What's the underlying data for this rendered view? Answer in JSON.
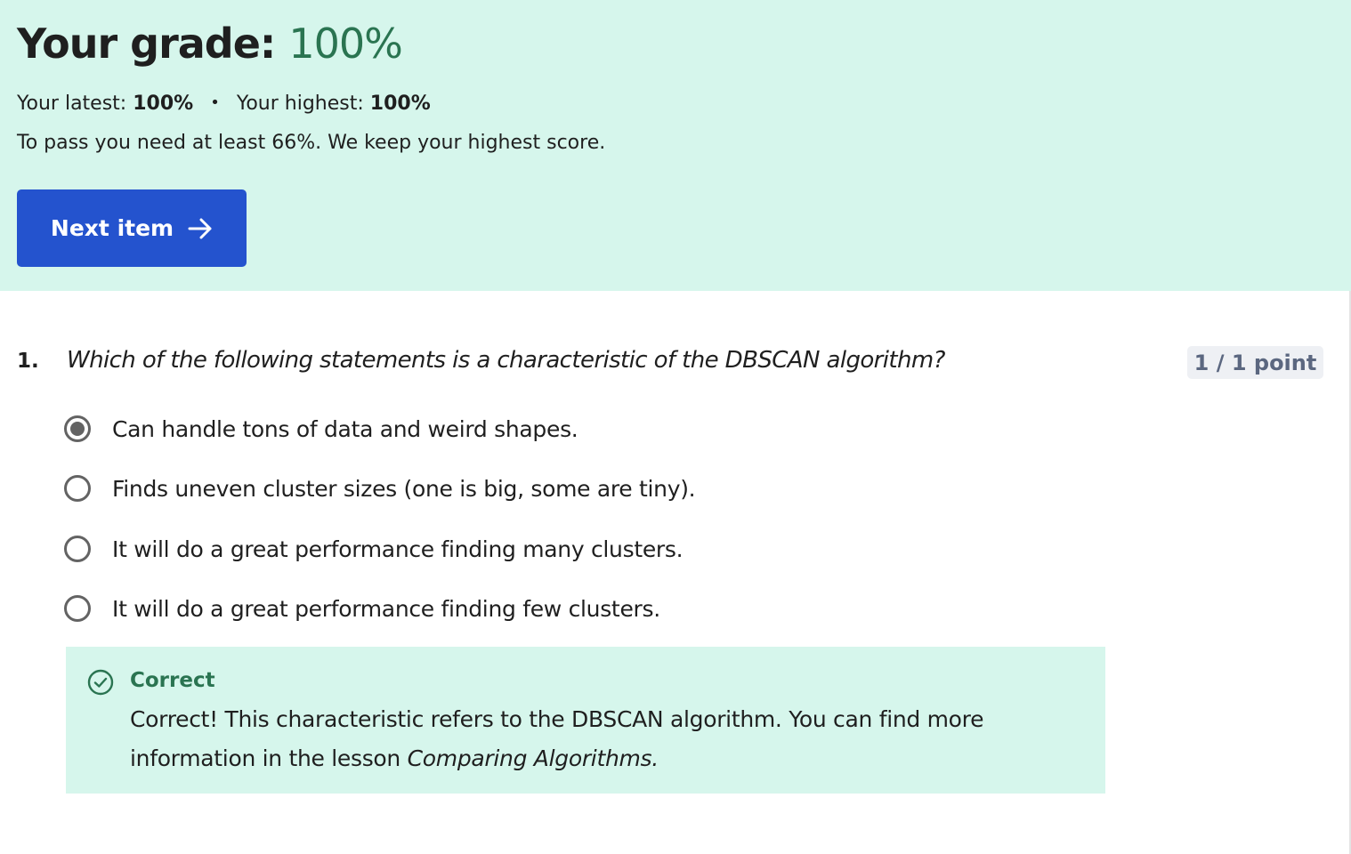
{
  "grade": {
    "label": "Your grade:",
    "value": "100%",
    "latest_label": "Your latest:",
    "latest_value": "100%",
    "separator": "•",
    "highest_label": "Your highest:",
    "highest_value": "100%",
    "pass_text": "To pass you need at least 66%. We keep your highest score.",
    "next_button_label": "Next item",
    "colors": {
      "banner_bg": "#d6f6ec",
      "grade_green": "#2a7451",
      "button_blue": "#2453ce"
    }
  },
  "question": {
    "number": "1.",
    "text": "Which of the following statements is a characteristic of the DBSCAN algorithm?",
    "points": "1 / 1 point",
    "options": [
      {
        "label": "Can handle tons of data and weird shapes.",
        "selected": true
      },
      {
        "label": "Finds uneven cluster sizes (one is big, some are tiny).",
        "selected": false
      },
      {
        "label": "It will do a great performance finding many clusters.",
        "selected": false
      },
      {
        "label": "It will do a great performance finding few clusters.",
        "selected": false
      }
    ]
  },
  "feedback": {
    "icon": "check-circle-icon",
    "title": "Correct",
    "text_before": "Correct! This characteristic refers to the DBSCAN algorithm. You can find more information in the lesson ",
    "lesson_name": "Comparing Algorithms."
  }
}
